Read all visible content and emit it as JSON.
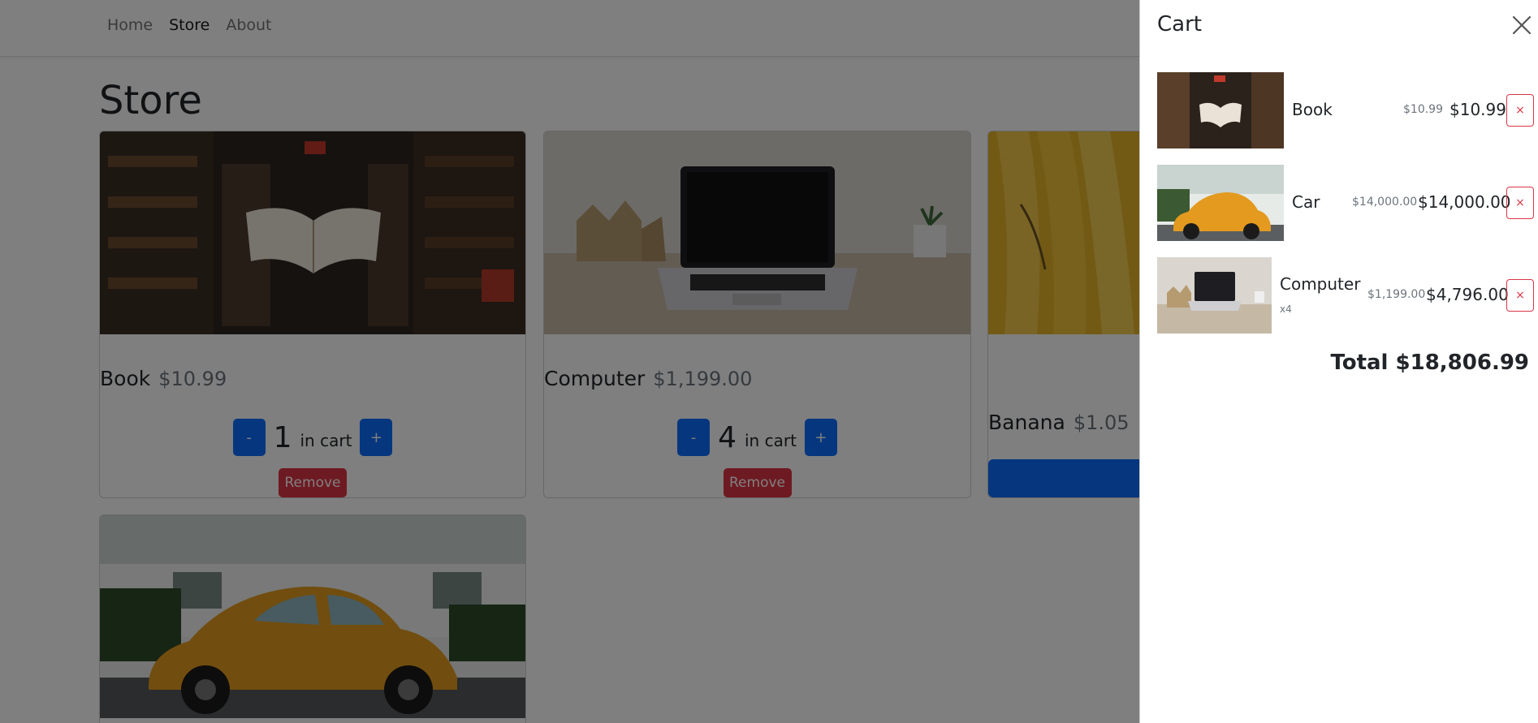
{
  "nav": {
    "items": [
      {
        "label": "Home"
      },
      {
        "label": "Store"
      },
      {
        "label": "About"
      }
    ]
  },
  "page": {
    "title": "Store"
  },
  "store": {
    "items": [
      {
        "name": "Book",
        "price": "$10.99",
        "quantity": "1",
        "in_cart_label": "in cart",
        "decrement_label": "-",
        "increment_label": "+",
        "remove_label": "Remove"
      },
      {
        "name": "Computer",
        "price": "$1,199.00",
        "quantity": "4",
        "in_cart_label": "in cart",
        "decrement_label": "-",
        "increment_label": "+",
        "remove_label": "Remove"
      },
      {
        "name": "Banana",
        "price": "$1.05"
      },
      {
        "name": "Car"
      }
    ]
  },
  "cart": {
    "title": "Cart",
    "close_icon": "close-icon",
    "items": [
      {
        "name": "Book",
        "qty_label": "",
        "unit_price": "$10.99",
        "subtotal": "$10.99",
        "remove_label": "×"
      },
      {
        "name": "Car",
        "qty_label": "",
        "unit_price": "$14,000.00",
        "subtotal": "$14,000.00",
        "remove_label": "×"
      },
      {
        "name": "Computer",
        "qty_label": "x4",
        "unit_price": "$1,199.00",
        "subtotal": "$4,796.00",
        "remove_label": "×"
      }
    ],
    "total": "Total $18,806.99"
  },
  "colors": {
    "primary": "#0d6efd",
    "danger": "#dc3545",
    "backdrop": "rgba(0,0,0,0.5)"
  }
}
